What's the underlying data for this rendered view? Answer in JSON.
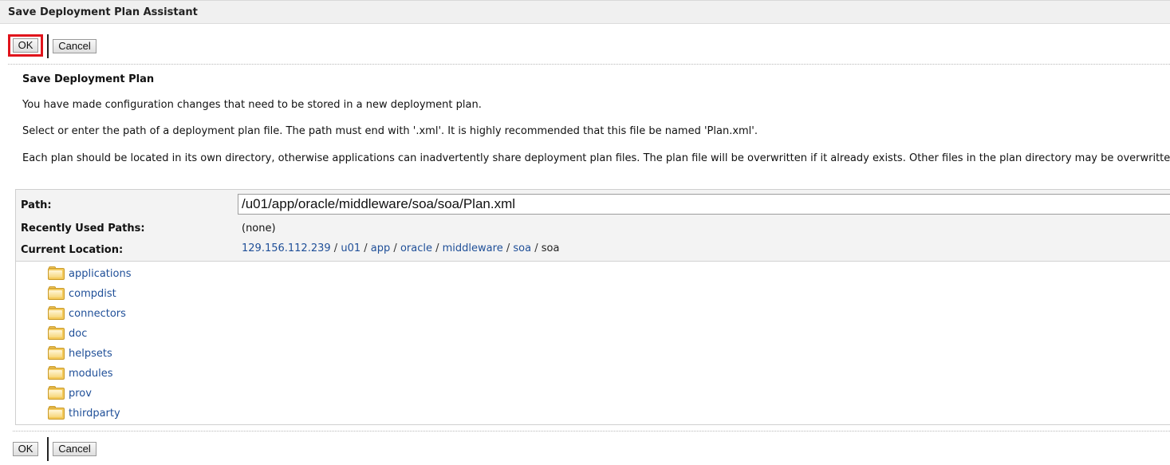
{
  "window": {
    "title": "Save Deployment Plan Assistant"
  },
  "buttons": {
    "ok": "OK",
    "cancel": "Cancel"
  },
  "section": {
    "title": "Save Deployment Plan",
    "paragraphs": [
      "You have made configuration changes that need to be stored in a new deployment plan.",
      "Select or enter the path of a deployment plan file. The path must end with '.xml'. It is highly recommended that this file be named 'Plan.xml'.",
      "Each plan should be located in its own directory, otherwise applications can inadvertently share deployment plan files. The plan file will be overwritten if it already exists. Other files in the plan directory may be overwritten as well."
    ]
  },
  "form": {
    "path_label": "Path:",
    "path_value": "/u01/app/oracle/middleware/soa/soa/Plan.xml",
    "recent_label": "Recently Used Paths:",
    "recent_value": "(none)",
    "location_label": "Current Location:",
    "location_crumbs": [
      "129.156.112.239",
      "u01",
      "app",
      "oracle",
      "middleware",
      "soa"
    ],
    "location_current": "soa",
    "separator": "/"
  },
  "folders": [
    "applications",
    "compdist",
    "connectors",
    "doc",
    "helpsets",
    "modules",
    "prov",
    "thirdparty"
  ],
  "icons": {
    "folder": "folder-icon"
  },
  "colors": {
    "link": "#1f4f98",
    "highlight": "#e0141c",
    "panel": "#f3f3f3"
  }
}
